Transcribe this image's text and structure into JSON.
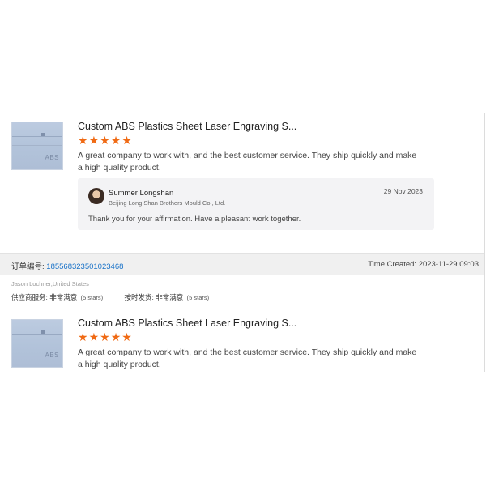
{
  "review1": {
    "product_title": "Custom ABS Plastics Sheet Laser Engraving S...",
    "thumb_label": "ABS",
    "rating": 5,
    "text": "A great company to work with, and the best customer service. They ship quickly and make a high quality product.",
    "reply": {
      "name": "Summer Longshan",
      "company": "Beijing Long Shan Brothers Mould Co., Ltd.",
      "date": "29 Nov 2023",
      "text": "Thank you for your affirmation. Have a pleasant work together."
    }
  },
  "order": {
    "label": "订单编号:",
    "number": "185568323501023468",
    "time": "Time Created: 2023-11-29 09:03",
    "buyer": "Jason Lochner,United States",
    "ratings": [
      {
        "label": "供应商服务:",
        "value": "非常满意",
        "stars_text": "(5 stars)"
      },
      {
        "label": "按时发货:",
        "value": "非常满意",
        "stars_text": "(5 stars)"
      }
    ]
  },
  "review2": {
    "product_title": "Custom ABS Plastics Sheet Laser Engraving S...",
    "thumb_label": "ABS",
    "rating": 5,
    "text": "A great company to work with, and the best customer service. They ship quickly and make a high quality product."
  },
  "colors": {
    "star": "#f06a14",
    "order_number": "#1a73c9",
    "reply_bg": "#f3f3f5",
    "order_header_bg": "#f0f0f0"
  }
}
